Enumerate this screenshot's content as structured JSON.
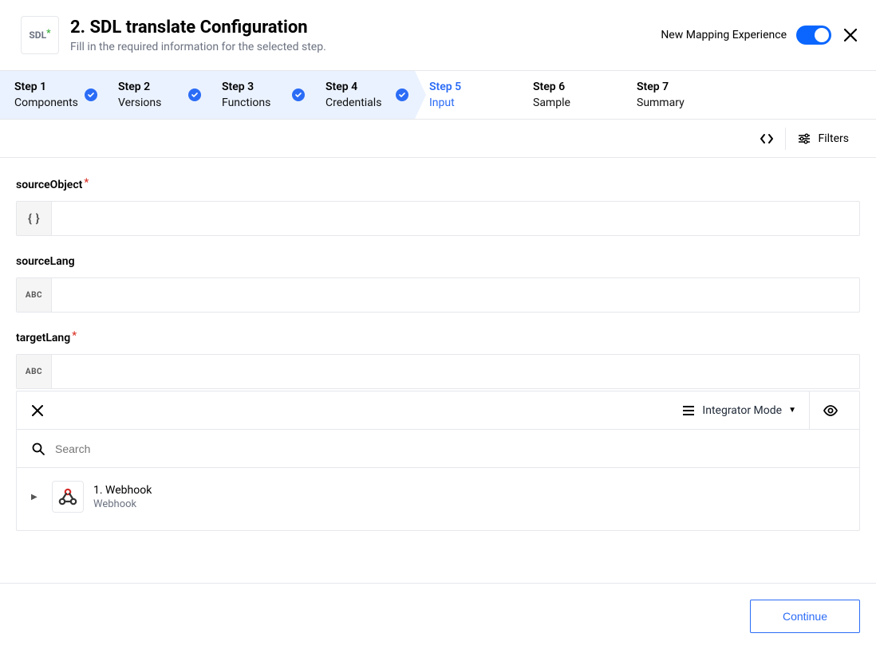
{
  "header": {
    "logo_text": "SDL",
    "title": "2. SDL translate Configuration",
    "subtitle": "Fill in the required information for the selected step.",
    "mapping_label": "New Mapping Experience"
  },
  "steps": [
    {
      "title": "Step 1",
      "sub": "Components",
      "status": "completed"
    },
    {
      "title": "Step 2",
      "sub": "Versions",
      "status": "completed"
    },
    {
      "title": "Step 3",
      "sub": "Functions",
      "status": "completed"
    },
    {
      "title": "Step 4",
      "sub": "Credentials",
      "status": "completed"
    },
    {
      "title": "Step 5",
      "sub": "Input",
      "status": "active"
    },
    {
      "title": "Step 6",
      "sub": "Sample",
      "status": "pending"
    },
    {
      "title": "Step 7",
      "sub": "Summary",
      "status": "pending"
    }
  ],
  "toolbar": {
    "filters_label": "Filters"
  },
  "fields": {
    "sourceObject": {
      "label": "sourceObject",
      "required": true,
      "type_badge": "{ }"
    },
    "sourceLang": {
      "label": "sourceLang",
      "required": false,
      "type_badge": "ABC"
    },
    "targetLang": {
      "label": "targetLang",
      "required": true,
      "type_badge": "ABC"
    }
  },
  "picker": {
    "mode_label": "Integrator Mode",
    "search_placeholder": "Search",
    "item": {
      "title": "1. Webhook",
      "subtitle": "Webhook"
    }
  },
  "footer": {
    "continue_label": "Continue"
  }
}
